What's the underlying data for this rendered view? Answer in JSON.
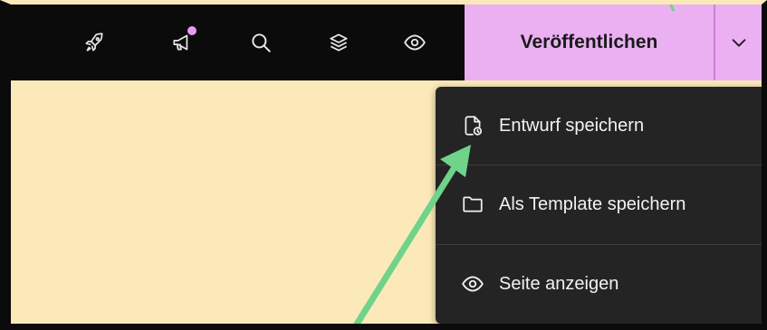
{
  "toolbar": {
    "icons": [
      "rocket-icon",
      "megaphone-icon",
      "search-icon",
      "layers-icon",
      "eye-icon"
    ],
    "publish_label": "Veröffentlichen",
    "dropdown_icon": "chevron-down-icon"
  },
  "menu": {
    "items": [
      {
        "label": "Entwurf speichern",
        "icon": "file-clock-icon"
      },
      {
        "label": "Als Template speichern",
        "icon": "folder-icon"
      },
      {
        "label": "Seite anzeigen",
        "icon": "eye-icon"
      }
    ]
  },
  "colors": {
    "accent": "#eab0f2",
    "notification_dot": "#e79af2",
    "background": "#fbe9b9",
    "toolbar": "#0b0b0b",
    "menu": "#242424",
    "annotation_arrow": "#6fd38a"
  }
}
